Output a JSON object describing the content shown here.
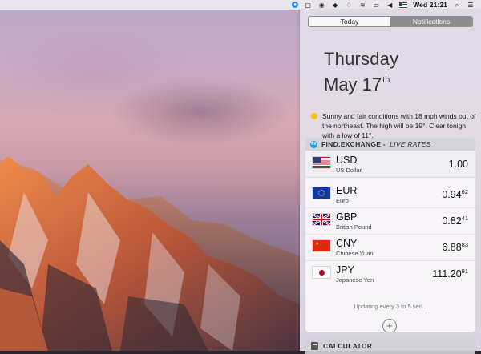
{
  "menubar": {
    "flag_icon": "us-flag-icon",
    "clock": "Wed 21:21"
  },
  "notification_center": {
    "tabs": [
      {
        "label": "Today",
        "selected": true
      },
      {
        "label": "Notifications",
        "selected": false
      }
    ],
    "day_name": "Thursday",
    "date_month_day": "May 17",
    "date_suffix": "th",
    "weather": {
      "icon": "sun-icon",
      "text": "Sunny and fair conditions with 18 mph winds out of the northeast. The high will be 19°. Clear tonigh with a low of 11°."
    },
    "exchange_widget": {
      "title_main": "FIND.EXCHANGE -",
      "title_sub": "LIVE RATES",
      "rates": [
        {
          "code": "USD",
          "name": "US Dollar",
          "rate_main": "1.00",
          "rate_sup": ""
        },
        {
          "code": "EUR",
          "name": "Euro",
          "rate_main": "0.94",
          "rate_sup": "62"
        },
        {
          "code": "GBP",
          "name": "British Pound",
          "rate_main": "0.82",
          "rate_sup": "41"
        },
        {
          "code": "CNY",
          "name": "Chinese Yuan",
          "rate_main": "6.88",
          "rate_sup": "83"
        },
        {
          "code": "JPY",
          "name": "Japanese Yen",
          "rate_main": "111.20",
          "rate_sup": "91"
        }
      ],
      "updating_text": "Updating every 3 to 5 sec...",
      "add_label": "+"
    },
    "calculator_widget": {
      "title": "CALCULATOR"
    }
  },
  "colors": {
    "accent_blue": "#1d9fe0",
    "sun": "#f5c21a"
  }
}
